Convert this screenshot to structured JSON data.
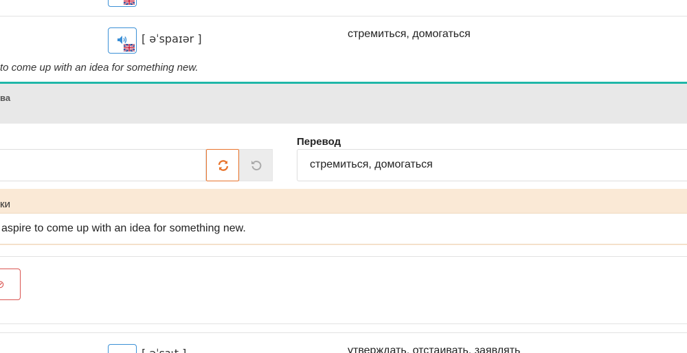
{
  "prev_row": {
    "audio_icon": "speaker-icon",
    "flag_icon": "uk-flag-icon"
  },
  "word_row": {
    "transcription": "[ əˈspaɪər ]",
    "translation": "стремиться, домогаться",
    "example": "to come up with an idea for something new."
  },
  "edit_panel": {
    "header_label": "ва",
    "translation_label": "Перевод",
    "translation_value": "стремиться, домогаться",
    "word_value": "",
    "refresh_icon": "refresh-icon",
    "undo_icon": "undo-icon",
    "examples_label": "ки",
    "example_value": "aspire to come up with an idea for something new.",
    "delete_glyph": "⊘",
    "accent_color": "#1fb7a8",
    "refresh_color": "#e8742c",
    "delete_color": "#d9534f"
  },
  "next_row": {
    "transcription": "[ əˈsɜːt ]",
    "translation": "утверждать, отстаивать, заявлять"
  }
}
